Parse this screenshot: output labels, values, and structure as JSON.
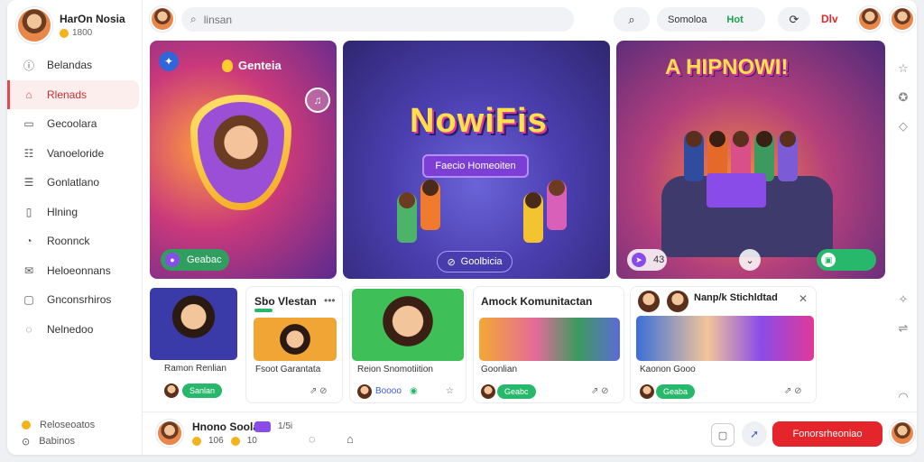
{
  "profile": {
    "name": "HarOn Nosia",
    "sub": "1800"
  },
  "nav": [
    {
      "label": "Belandas",
      "icon": "ⓘ"
    },
    {
      "label": "Rlenads",
      "icon": "⌂"
    },
    {
      "label": "Gecoolara",
      "icon": "▭"
    },
    {
      "label": "Vanoeloride",
      "icon": "☷"
    },
    {
      "label": "Gonlatlano",
      "icon": "☰"
    },
    {
      "label": "Hlning",
      "icon": "▯"
    },
    {
      "label": "Roonnck",
      "icon": "◔"
    },
    {
      "label": "Heloeonnans",
      "icon": "✉"
    },
    {
      "label": "Gnconsrhiros",
      "icon": "▢"
    },
    {
      "label": "Nelnedoo",
      "icon": "◌"
    }
  ],
  "side_footer": [
    "Reloseoatos",
    "Babinos"
  ],
  "search": {
    "placeholder": "linsan"
  },
  "topbar": {
    "pill_a": "Somoloa",
    "pill_b": "Hot",
    "live": "Dlv"
  },
  "big_cards": {
    "c1": {
      "title": "Genteia",
      "chip": "Geabac"
    },
    "c2": {
      "logo": "NowiFis",
      "tag": "Faecio Homeoiten",
      "chip": "Goolbicia"
    },
    "c3": {
      "title": "A HIPNOWI!",
      "badge": "43"
    }
  },
  "small_cards": {
    "s1": {
      "caption": "Ramon Renlian"
    },
    "s2": {
      "title": "Sbo Vlestan",
      "caption": "Fsoot Garantata"
    },
    "s3": {
      "caption": "Reion Snomotiition",
      "chip": "Boooo"
    },
    "s4": {
      "title": "Amock Komunitactan",
      "caption": "Goonlian",
      "chip": "Geabc"
    },
    "s5": {
      "title": "Nanp/k Stichldtad",
      "caption": "Kaonon Gooo",
      "chip": "Geaba"
    },
    "generic_chip": "Sanlan"
  },
  "bottom": {
    "name": "Hnono Soola",
    "count": "1/5i",
    "meta_a": "106",
    "meta_b": "10",
    "cta": "Fonorsrheoniao"
  },
  "colors": {
    "accent": "#e4262c",
    "green": "#27b86b",
    "purple": "#8a4ce8"
  }
}
